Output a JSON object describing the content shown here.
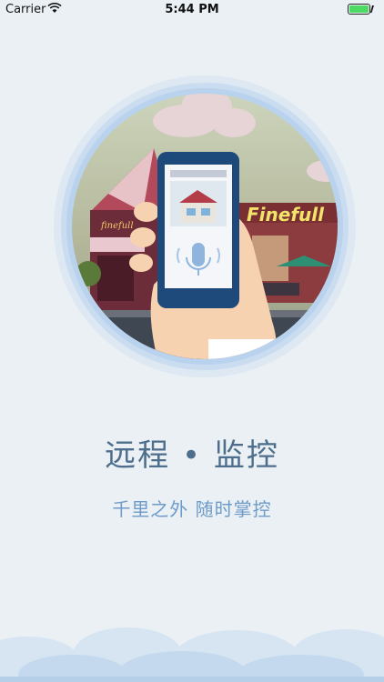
{
  "status_bar": {
    "carrier": "Carrier",
    "time": "5:44 PM"
  },
  "hero": {
    "shop_sign": "finefull",
    "shop_sign_right": "Finefull"
  },
  "content": {
    "title": "远程 • 监控",
    "subtitle": "千里之外  随时掌控"
  },
  "colors": {
    "background": "#eaf0f4",
    "title": "#4d6e8c",
    "subtitle": "#6e9bc8",
    "battery": "#4cd964",
    "ring": "#b9d2ee"
  }
}
